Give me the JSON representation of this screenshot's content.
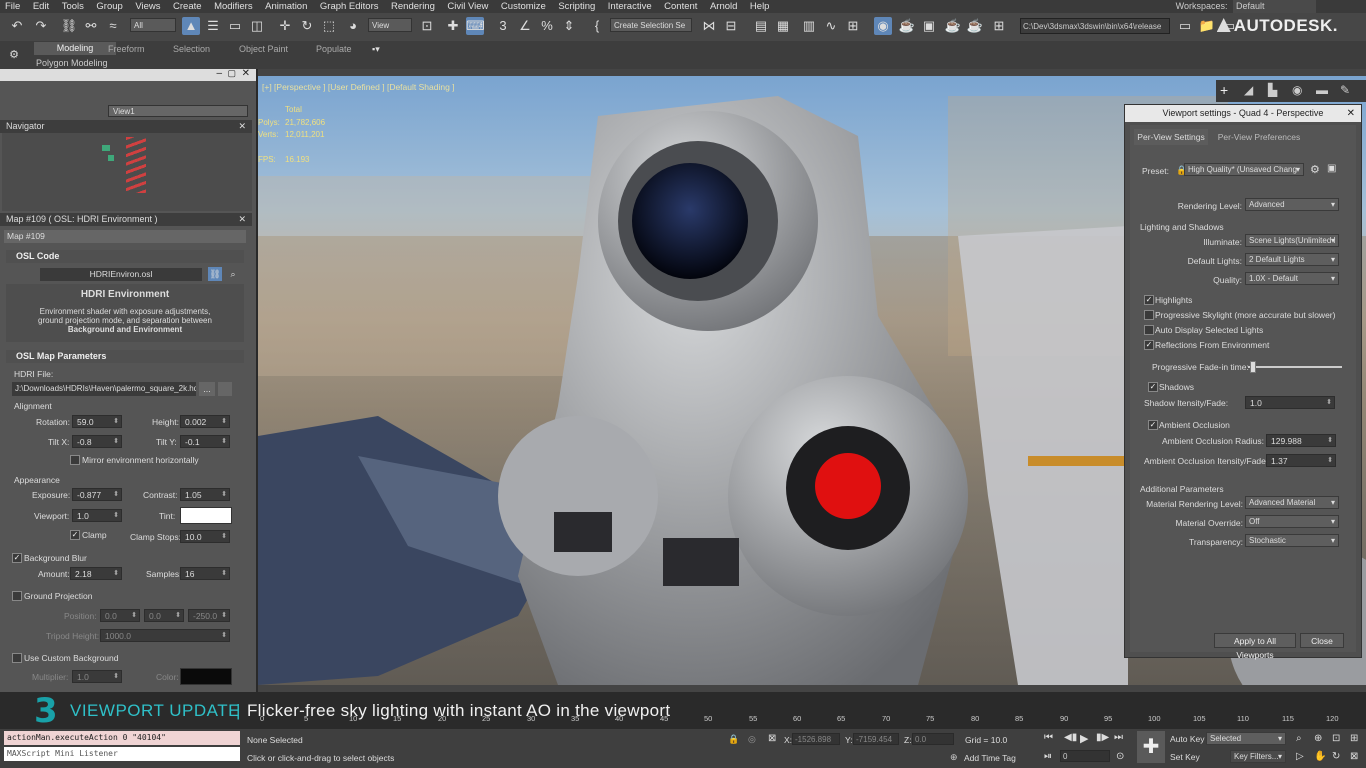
{
  "menu": {
    "items": [
      "File",
      "Edit",
      "Tools",
      "Group",
      "Views",
      "Create",
      "Modifiers",
      "Animation",
      "Graph Editors",
      "Rendering",
      "Civil View",
      "Customize",
      "Scripting",
      "Interactive",
      "Content",
      "Arnold",
      "Help"
    ],
    "workspaces_label": "Workspaces:",
    "workspaces_value": "Default"
  },
  "toolbar": {
    "selection_filter": "All",
    "ref_coord": "View",
    "named_selection": "Create Selection Se",
    "project_path": "C:\\Dev\\3dsmax\\3dswin\\bin\\x64\\release",
    "brand": "AUTODESK."
  },
  "ribbon": {
    "tabs": [
      "Modeling",
      "Freeform",
      "Selection",
      "Object Paint",
      "Populate"
    ],
    "sub_label": "Polygon Modeling"
  },
  "left_panel": {
    "view_dropdown": "View1",
    "navigator_title": "Navigator",
    "map_title": "Map #109  ( OSL: HDRI Environment )",
    "map_name": "Map #109",
    "osl_code_header": "OSL Code",
    "osl_file": "HDRIEnviron.osl",
    "shader_title": "HDRI Environment",
    "shader_desc_1": "Environment shader with exposure adjustments,",
    "shader_desc_2": "ground projection mode, and separation between",
    "shader_desc_3": "Background and Environment",
    "params_header": "OSL Map Parameters",
    "hdri_file_label": "HDRI File:",
    "hdri_file_path": "J:\\Downloads\\HDRIs\\Haven\\palermo_square_2k.hdr",
    "browse_label": "...",
    "alignment_label": "Alignment",
    "rotation_label": "Rotation:",
    "rotation_value": "59.0",
    "height_label": "Height:",
    "height_value": "0.002",
    "tiltx_label": "Tilt X:",
    "tiltx_value": "-0.8",
    "tilty_label": "Tilt Y:",
    "tilty_value": "-0.1",
    "mirror_label": "Mirror environment horizontally",
    "appearance_label": "Appearance",
    "exposure_label": "Exposure:",
    "exposure_value": "-0.877",
    "contrast_label": "Contrast:",
    "contrast_value": "1.05",
    "viewport_label": "Viewport:",
    "viewport_value": "1.0",
    "tint_label": "Tint:",
    "clamp_label": "Clamp",
    "clampstops_label": "Clamp Stops:",
    "clampstops_value": "10.0",
    "bgblur_label": "Background Blur",
    "amount_label": "Amount:",
    "amount_value": "2.18",
    "samples_label": "Samples:",
    "samples_value": "16",
    "groundproj_label": "Ground Projection",
    "position_label": "Position:",
    "pos_x": "0.0",
    "pos_y": "0.0",
    "pos_z": "-250.0",
    "tripod_label": "Tripod Height:",
    "tripod_value": "1000.0",
    "custombg_label": "Use Custom Background",
    "multiplier_label": "Multiplier:",
    "multiplier_value": "1.0",
    "color_label": "Color:"
  },
  "viewport": {
    "label": "[+] [Perspective ] [User Defined ] [Default Shading ]",
    "total_label": "Total",
    "polys_label": "Polys:",
    "polys_value": "21,782,606",
    "verts_label": "Verts:",
    "verts_value": "12,011,201",
    "fps_label": "FPS:",
    "fps_value": "16.193"
  },
  "vp_settings": {
    "title": "Viewport settings - Quad 4 - Perspective",
    "tab_active": "Per-View Settings",
    "tab_inactive": "Per-View Preferences",
    "preset_label": "Preset:",
    "preset_value": "High Quality* (Unsaved Chang",
    "rendering_level_label": "Rendering Level:",
    "rendering_level_value": "Advanced",
    "lighting_header": "Lighting and Shadows",
    "illuminate_label": "Illuminate:",
    "illuminate_value": "Scene Lights(Unlimited l",
    "default_lights_label": "Default Lights:",
    "default_lights_value": "2 Default Lights",
    "quality_label": "Quality:",
    "quality_value": "1.0X - Default",
    "highlights_label": "Highlights",
    "prog_skylight_label": "Progressive Skylight (more accurate but slower)",
    "auto_display_label": "Auto Display Selected Lights",
    "reflections_label": "Reflections From Environment",
    "fade_label": "Progressive Fade-in time:",
    "shadows_label": "Shadows",
    "shadow_intensity_label": "Shadow Itensity/Fade:",
    "shadow_intensity_value": "1.0",
    "ao_label": "Ambient Occlusion",
    "ao_radius_label": "Ambient Occlusion Radius:",
    "ao_radius_value": "129.988",
    "ao_intensity_label": "Ambient Occlusion Itensity/Fade:",
    "ao_intensity_value": "1.37",
    "additional_header": "Additional Parameters",
    "mat_level_label": "Material Rendering Level:",
    "mat_level_value": "Advanced Material",
    "mat_override_label": "Material Override:",
    "mat_override_value": "Off",
    "transparency_label": "Transparency:",
    "transparency_value": "Stochastic",
    "apply_button": "Apply to All Viewports",
    "close_button": "Close"
  },
  "banner": {
    "logo": "3",
    "title": "VIEWPORT UPDATE",
    "separator": "|",
    "text": "Flicker-free sky lighting with instant AO in the viewport"
  },
  "timeline": {
    "ticks": [
      "0",
      "5",
      "10",
      "15",
      "20",
      "25",
      "30",
      "35",
      "40",
      "45",
      "50",
      "55",
      "60",
      "65",
      "70",
      "75",
      "80",
      "85",
      "90",
      "95",
      "100",
      "105",
      "110",
      "115",
      "120"
    ]
  },
  "status": {
    "maxscript_output": "actionMan.executeAction 0 \"40104\"",
    "maxscript_listener": "MAXScript Mini Listener",
    "selection": "None Selected",
    "prompt": "Click or click-and-drag to select objects",
    "x_label": "X:",
    "x_value": "-1526.898",
    "y_label": "Y:",
    "y_value": "-7159.454",
    "z_label": "Z:",
    "z_value": "0.0",
    "grid": "Grid = 10.0",
    "add_time_tag": "Add Time Tag",
    "frame": "0",
    "auto_key": "Auto Key",
    "set_key": "Set Key",
    "selected_dropdown": "Selected",
    "key_filters": "Key Filters..."
  },
  "colors": {
    "accent_teal": "#2fc0c8",
    "eye_red": "#e01010",
    "panel_bg": "#555555"
  }
}
